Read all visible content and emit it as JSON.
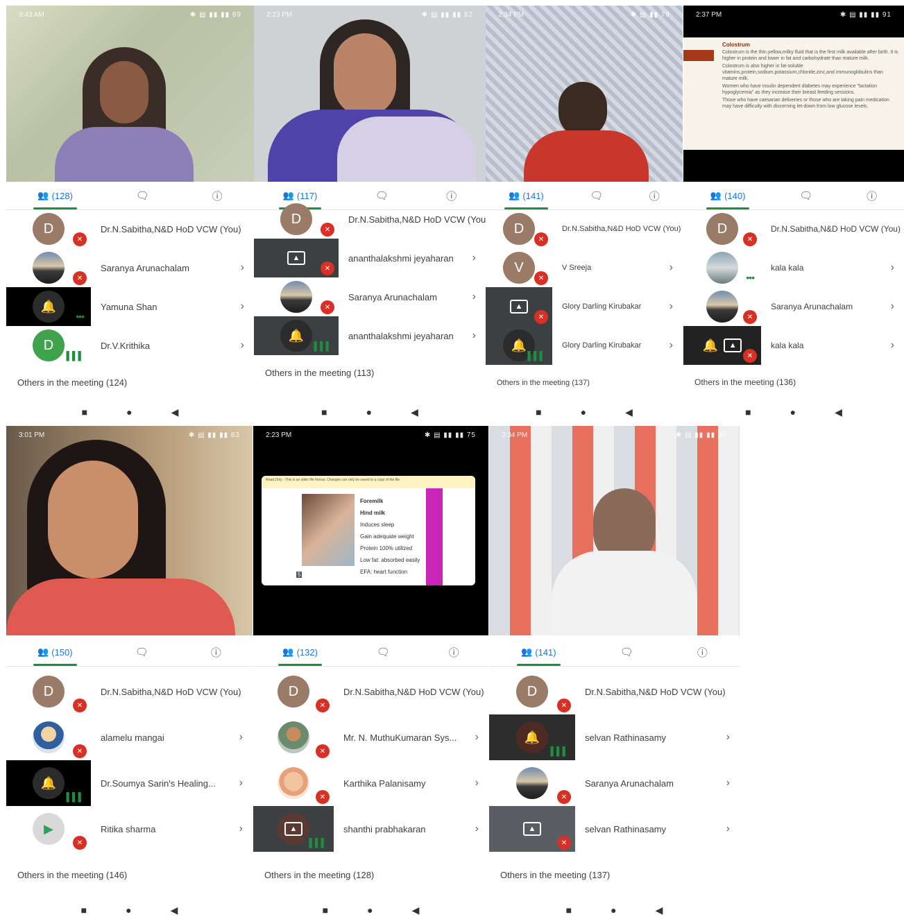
{
  "panels": [
    {
      "time": "9:43 AM",
      "battery": "89",
      "participants_count": "(128)",
      "others": "Others in the meeting (124)",
      "people": [
        {
          "name": "Dr.N.Sabitha,N&D HoD VCW (You)",
          "avatar": "D"
        },
        {
          "name": "Saranya Arunachalam"
        },
        {
          "name": "Yamuna Shan"
        },
        {
          "name": "Dr.V.Krithika",
          "avatar": "D"
        }
      ]
    },
    {
      "time": "2:23 PM",
      "battery": "82",
      "participants_count": "(117)",
      "others": "Others in the meeting (113)",
      "people": [
        {
          "name": "Dr.N.Sabitha,N&D HoD VCW (You)",
          "avatar": "D"
        },
        {
          "name": "ananthalakshmi jeyaharan"
        },
        {
          "name": "Saranya Arunachalam"
        },
        {
          "name": "ananthalakshmi jeyaharan"
        }
      ]
    },
    {
      "time": "2:34 PM",
      "battery": "79",
      "participants_count": "(141)",
      "others": "Others in the meeting (137)",
      "people": [
        {
          "name": "Dr.N.Sabitha,N&D HoD VCW (You)",
          "avatar": "D"
        },
        {
          "name": "V Sreeja",
          "avatar": "V"
        },
        {
          "name": "Glory Darling Kirubakar"
        },
        {
          "name": "Glory Darling Kirubakar"
        }
      ]
    },
    {
      "time": "2:37 PM",
      "battery": "91",
      "participants_count": "(140)",
      "others": "Others in the meeting (136)",
      "slide": {
        "title": "Colostrum",
        "bullets": [
          "Colostrum is the thin,yellow,milky fluid that is the first milk available after birth. It is higher in protein and lower in fat and carbohydrate than mature milk.",
          "Colostrum is also higher in fat-soluble vitamins,protein,sodium,potassium,chloride,zinc,and immunoglobulins than mature milk.",
          "Women who have insulin dependent diabetes may experience \"lactation hypoglycemia\" as they increase their breast feeding sessions.",
          "Those who have caesarian deliveries or those who are taking pain medication may have difficulty with discerning let-down from low glucose levels."
        ]
      },
      "people": [
        {
          "name": "Dr.N.Sabitha,N&D HoD VCW (You)",
          "avatar": "D"
        },
        {
          "name": "kala kala"
        },
        {
          "name": "Saranya Arunachalam"
        },
        {
          "name": "kala kala"
        }
      ]
    },
    {
      "time": "3:01 PM",
      "battery": "83",
      "participants_count": "(150)",
      "others": "Others in the meeting (146)",
      "people": [
        {
          "name": "Dr.N.Sabitha,N&D HoD VCW (You)",
          "avatar": "D"
        },
        {
          "name": "alamelu mangai"
        },
        {
          "name": "Dr.Soumya Sarin's Healing..."
        },
        {
          "name": "Ritika sharma"
        }
      ]
    },
    {
      "time": "2:23 PM",
      "battery": "75",
      "participants_count": "(132)",
      "others": "Others in the meeting (128)",
      "slide": {
        "banner": "Read Only - This is an older file format. Changes can only be saved to a copy of the file.",
        "lines": [
          "Foremilk",
          "Hind milk",
          "Induces sleep",
          "Gain adequate weight",
          "Protein 100% utilized",
          "Low fat: absorbed easily",
          "EFA: heart function"
        ],
        "page": "5"
      },
      "people": [
        {
          "name": "Dr.N.Sabitha,N&D HoD VCW (You)",
          "avatar": "D"
        },
        {
          "name": "Mr. N. MuthuKumaran Sys..."
        },
        {
          "name": "Karthika Palanisamy"
        },
        {
          "name": "shanthi prabhakaran"
        }
      ]
    },
    {
      "time": "3:34 PM",
      "battery": "90",
      "participants_count": "(141)",
      "others": "Others in the meeting (137)",
      "people": [
        {
          "name": "Dr.N.Sabitha,N&D HoD VCW (You)",
          "avatar": "D"
        },
        {
          "name": "selvan Rathinasamy"
        },
        {
          "name": "Saranya Arunachalam"
        },
        {
          "name": "selvan Rathinasamy"
        }
      ]
    }
  ],
  "icons": {
    "people": "people-icon",
    "chat": "chat-icon",
    "info": "info-icon",
    "mic_off": "mic-off-icon",
    "chevron": "chevron-right-icon",
    "nav": [
      "square-nav-icon",
      "circle-nav-icon",
      "back-nav-icon"
    ]
  },
  "colors": {
    "tab_accent": "#1e8e3e",
    "link": "#1a73e8",
    "muted": "#d93025"
  }
}
